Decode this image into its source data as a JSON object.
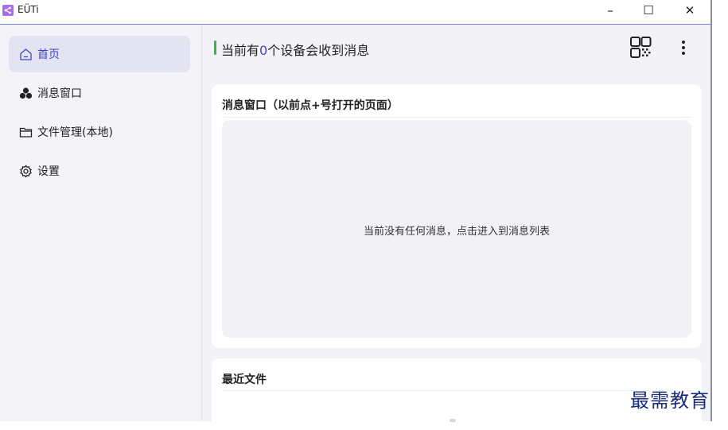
{
  "window": {
    "title": "EÜTi",
    "minimize_glyph": "–",
    "maximize_glyph": "☐",
    "close_glyph": "✕"
  },
  "sidebar": {
    "items": [
      {
        "label": "首页",
        "icon": "home-icon",
        "active": true
      },
      {
        "label": "消息窗口",
        "icon": "messages-icon",
        "active": false
      },
      {
        "label": "文件管理(本地)",
        "icon": "folder-icon",
        "active": false
      },
      {
        "label": "设置",
        "icon": "gear-icon",
        "active": false
      }
    ]
  },
  "header": {
    "status_prefix": "当前有",
    "device_count": "0",
    "status_suffix": "个设备会收到消息",
    "qr_icon": "qr-code-icon",
    "more_icon": "more-vertical-icon"
  },
  "message_card": {
    "title": "消息窗口（以前点+号打开的页面）",
    "empty_text": "当前没有任何消息，点击进入到消息列表"
  },
  "files_card": {
    "title": "最近文件"
  },
  "watermark": "最需教育",
  "colors": {
    "accent": "#3f46c8",
    "status_green": "#3bb54a",
    "sidebar_bg": "#f3f3f8",
    "main_bg": "#f2f2f7"
  }
}
